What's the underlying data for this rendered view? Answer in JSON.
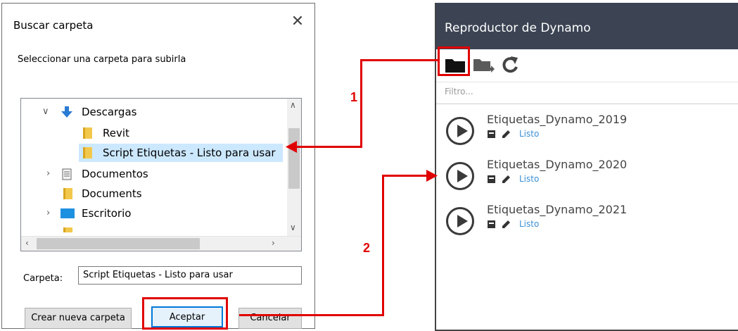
{
  "dialog": {
    "title": "Buscar carpeta",
    "close_glyph": "✕",
    "prompt": "Seleccionar una carpeta para subirla",
    "tree": [
      {
        "label": "Descargas",
        "icon": "download-arrow-icon"
      },
      {
        "label": "Revit",
        "icon": "folder-icon"
      },
      {
        "label": "Script Etiquetas - Listo para usar",
        "icon": "folder-icon",
        "selected": true
      },
      {
        "label": "Documentos",
        "icon": "documents-icon"
      },
      {
        "label": "Documents",
        "icon": "folder-icon"
      },
      {
        "label": "Escritorio",
        "icon": "desktop-icon"
      }
    ],
    "folder_label": "Carpeta:",
    "folder_value": "Script Etiquetas - Listo para usar",
    "buttons": {
      "new_folder": "Crear nueva carpeta",
      "accept": "Aceptar",
      "cancel": "Cancelar"
    }
  },
  "panel": {
    "title": "Reproductor de Dynamo",
    "filter_placeholder": "Filtro...",
    "graphs": [
      {
        "name": "Etiquetas_Dynamo_2019",
        "status": "Listo"
      },
      {
        "name": "Etiquetas_Dynamo_2020",
        "status": "Listo"
      },
      {
        "name": "Etiquetas_Dynamo_2021",
        "status": "Listo"
      }
    ]
  },
  "annotations": {
    "step1": "1",
    "step2": "2",
    "color": "#e00000"
  }
}
